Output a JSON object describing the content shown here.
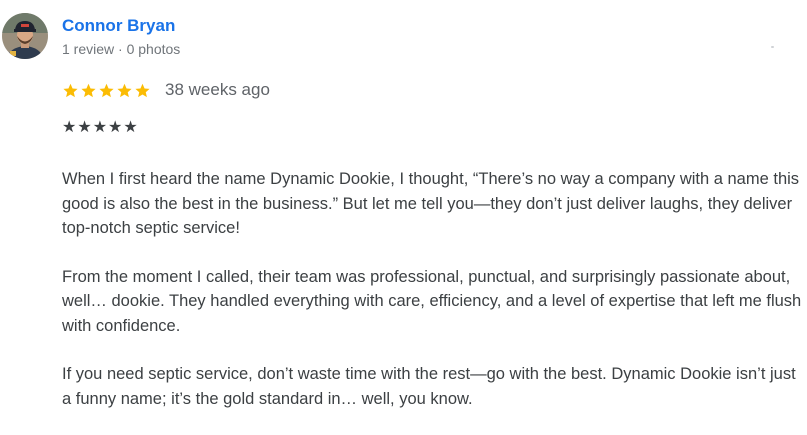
{
  "reviewer": {
    "name": "Connor Bryan",
    "meta": "1 review · 0 photos",
    "avatar_icon": "user-avatar-photo"
  },
  "rating": {
    "stars": 5,
    "max": 5,
    "star_color": "#fbbc04",
    "time_ago": "38 weeks ago"
  },
  "review": {
    "text_stars": "★★★★★",
    "paragraphs": [
      "When I first heard the name Dynamic Dookie, I thought, “There’s no way a company with a name this good is also the best in the business.” But let me tell you—they don’t just deliver laughs, they deliver top-notch septic service!",
      "From the moment I called, their team was professional, punctual, and surprisingly passionate about, well… dookie. They handled everything with care, efficiency, and a level of expertise that left me flush with confidence.",
      "If you need septic service, don’t waste time with the rest—go with the best. Dynamic Dookie isn’t just a funny name; it’s the gold standard in… well, you know."
    ]
  },
  "colors": {
    "name_link": "#1a73e8",
    "body_text": "#3c4043",
    "meta_text": "#70757a"
  }
}
